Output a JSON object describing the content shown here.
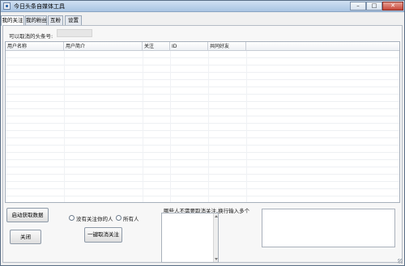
{
  "window": {
    "title": "今日头条自媒体工具",
    "minimize_symbol": "–",
    "maximize_symbol": "□",
    "close_symbol": "✕"
  },
  "tabs": [
    {
      "label": "我的关注",
      "active": true
    },
    {
      "label": "我的粉丝",
      "active": false
    },
    {
      "label": "互粉",
      "active": false
    },
    {
      "label": "设置",
      "active": false
    }
  ],
  "form": {
    "number_label": "可以取消的头条号:",
    "number_value": ""
  },
  "table": {
    "columns": [
      "用户名称",
      "用户简介",
      "关注",
      "ID",
      "共同好友",
      ""
    ],
    "rows": []
  },
  "buttons": {
    "start": "启动获取数据",
    "close": "关闭",
    "unfollow_all": "一键取消关注"
  },
  "radios": [
    {
      "label": "没有关注你的人",
      "checked": false
    },
    {
      "label": "所有人",
      "checked": false
    }
  ],
  "exclude": {
    "label": "哪些人不需要取消关注,换行输入多个",
    "value": ""
  },
  "notes": {
    "value": ""
  },
  "colors": {
    "titlebar": "#a9c4e2",
    "close_button": "#c6473a",
    "window_background": "#f0f0f0",
    "grid_background": "#ffffff"
  }
}
